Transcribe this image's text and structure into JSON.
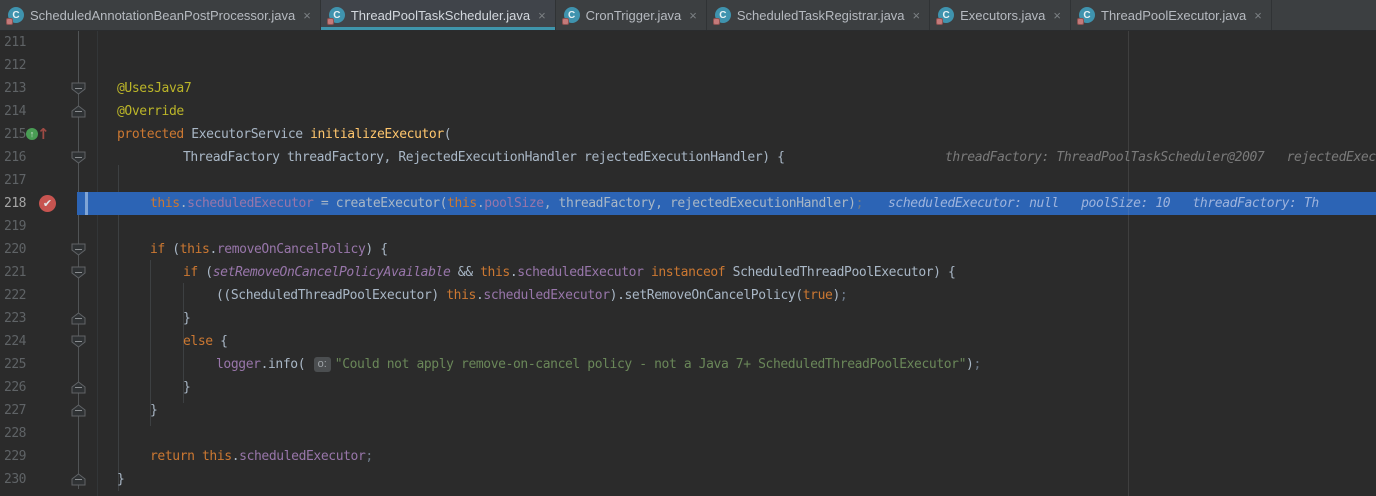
{
  "colors": {
    "accent_tab_underline": "#3f95ac",
    "keyword": "#cc7832",
    "annotation": "#bbb529",
    "method_decl": "#ffc66d",
    "field": "#9876aa",
    "string": "#6a8759",
    "exec_line_highlight": "#2c64b5",
    "breakpoint_red": "#c75450",
    "class_icon_teal": "#3f93ae"
  },
  "tabs": [
    {
      "label": "ScheduledAnnotationBeanPostProcessor.java",
      "close_label": "×",
      "active": false
    },
    {
      "label": "ThreadPoolTaskScheduler.java",
      "close_label": "×",
      "active": true
    },
    {
      "label": "CronTrigger.java",
      "close_label": "×",
      "active": false
    },
    {
      "label": "ScheduledTaskRegistrar.java",
      "close_label": "×",
      "active": false
    },
    {
      "label": "Executors.java",
      "close_label": "×",
      "active": false
    },
    {
      "label": "ThreadPoolExecutor.java",
      "close_label": "×",
      "active": false
    }
  ],
  "editor": {
    "breakpoint_check_glyph": "✔",
    "override_up_arrow_glyph": "↑",
    "implementing_circle_glyph": "↑",
    "lines": [
      {
        "num": "211",
        "indent": 0,
        "segs": []
      },
      {
        "num": "212",
        "indent": 0,
        "segs": []
      },
      {
        "num": "213",
        "indent": 1,
        "fold": "down",
        "segs": [
          [
            "ann",
            "@UsesJava7"
          ]
        ]
      },
      {
        "num": "214",
        "indent": 1,
        "fold": "up",
        "segs": [
          [
            "ann",
            "@Override"
          ]
        ]
      },
      {
        "num": "215",
        "indent": 1,
        "override_icon": true,
        "segs": [
          [
            "kw",
            "protected "
          ],
          [
            "def",
            "ExecutorService "
          ],
          [
            "m",
            "initializeExecutor"
          ],
          [
            "def",
            "("
          ]
        ]
      },
      {
        "num": "216",
        "indent": 3,
        "fold": "down",
        "segs": [
          [
            "def",
            "ThreadFactory threadFactory, RejectedExecutionHandler rejectedExecutionHandler) {"
          ]
        ],
        "hint": [
          "threadFactory: ThreadPoolTaskScheduler@2007",
          "rejectedExecutionHandl"
        ]
      },
      {
        "num": "217",
        "indent": 0,
        "segs": []
      },
      {
        "num": "218",
        "indent": 2,
        "highlight": true,
        "breakpoint": true,
        "segs": [
          [
            "kw",
            "this"
          ],
          [
            "def",
            "."
          ],
          [
            "fld",
            "scheduledExecutor"
          ],
          [
            "def",
            " = createExecutor("
          ],
          [
            "kw",
            "this"
          ],
          [
            "def",
            "."
          ],
          [
            "fld",
            "poolSize"
          ],
          [
            "def",
            ", threadFactory, rejectedExecutionHandler)"
          ],
          [
            "dim",
            ";"
          ]
        ],
        "hint": [
          "scheduledExecutor: null",
          "poolSize: 10",
          "threadFactory: Th"
        ]
      },
      {
        "num": "219",
        "indent": 0,
        "segs": []
      },
      {
        "num": "220",
        "indent": 2,
        "fold": "down",
        "segs": [
          [
            "kw",
            "if"
          ],
          [
            "def",
            " ("
          ],
          [
            "kw",
            "this"
          ],
          [
            "def",
            "."
          ],
          [
            "fld",
            "removeOnCancelPolicy"
          ],
          [
            "def",
            ") {"
          ]
        ]
      },
      {
        "num": "221",
        "indent": 3,
        "fold": "down",
        "segs": [
          [
            "kw",
            "if"
          ],
          [
            "def",
            " ("
          ],
          [
            "sfld",
            "setRemoveOnCancelPolicyAvailable"
          ],
          [
            "def",
            " && "
          ],
          [
            "kw",
            "this"
          ],
          [
            "def",
            "."
          ],
          [
            "fld",
            "scheduledExecutor"
          ],
          [
            "def",
            " "
          ],
          [
            "kw",
            "instanceof"
          ],
          [
            "def",
            " ScheduledThreadPoolExecutor) {"
          ]
        ]
      },
      {
        "num": "222",
        "indent": 4,
        "segs": [
          [
            "def",
            "((ScheduledThreadPoolExecutor) "
          ],
          [
            "kw",
            "this"
          ],
          [
            "def",
            "."
          ],
          [
            "fld",
            "scheduledExecutor"
          ],
          [
            "def",
            ").setRemoveOnCancelPolicy("
          ],
          [
            "kw",
            "true"
          ],
          [
            "def",
            ")"
          ],
          [
            "dim",
            ";"
          ]
        ]
      },
      {
        "num": "223",
        "indent": 3,
        "fold": "up",
        "segs": [
          [
            "def",
            "}"
          ]
        ]
      },
      {
        "num": "224",
        "indent": 3,
        "fold": "down",
        "segs": [
          [
            "kw",
            "else"
          ],
          [
            "def",
            " {"
          ]
        ]
      },
      {
        "num": "225",
        "indent": 4,
        "segs": [
          [
            "fld",
            "logger"
          ],
          [
            "def",
            "."
          ],
          [
            "def",
            "info"
          ],
          [
            "def",
            "( "
          ],
          [
            "badge",
            "o:"
          ],
          [
            "str",
            "\"Could not apply remove-on-cancel policy - not a Java 7+ ScheduledThreadPoolExecutor\""
          ],
          [
            "def",
            ")"
          ],
          [
            "dim",
            ";"
          ]
        ]
      },
      {
        "num": "226",
        "indent": 3,
        "fold": "up",
        "segs": [
          [
            "def",
            "}"
          ]
        ]
      },
      {
        "num": "227",
        "indent": 2,
        "fold": "up",
        "segs": [
          [
            "def",
            "}"
          ]
        ]
      },
      {
        "num": "228",
        "indent": 0,
        "segs": []
      },
      {
        "num": "229",
        "indent": 2,
        "segs": [
          [
            "kw",
            "return "
          ],
          [
            "kw",
            "this"
          ],
          [
            "def",
            "."
          ],
          [
            "fld",
            "scheduledExecutor"
          ],
          [
            "dim",
            ";"
          ]
        ]
      },
      {
        "num": "230",
        "indent": 1,
        "fold": "up",
        "segs": [
          [
            "def",
            "}"
          ]
        ]
      }
    ]
  }
}
